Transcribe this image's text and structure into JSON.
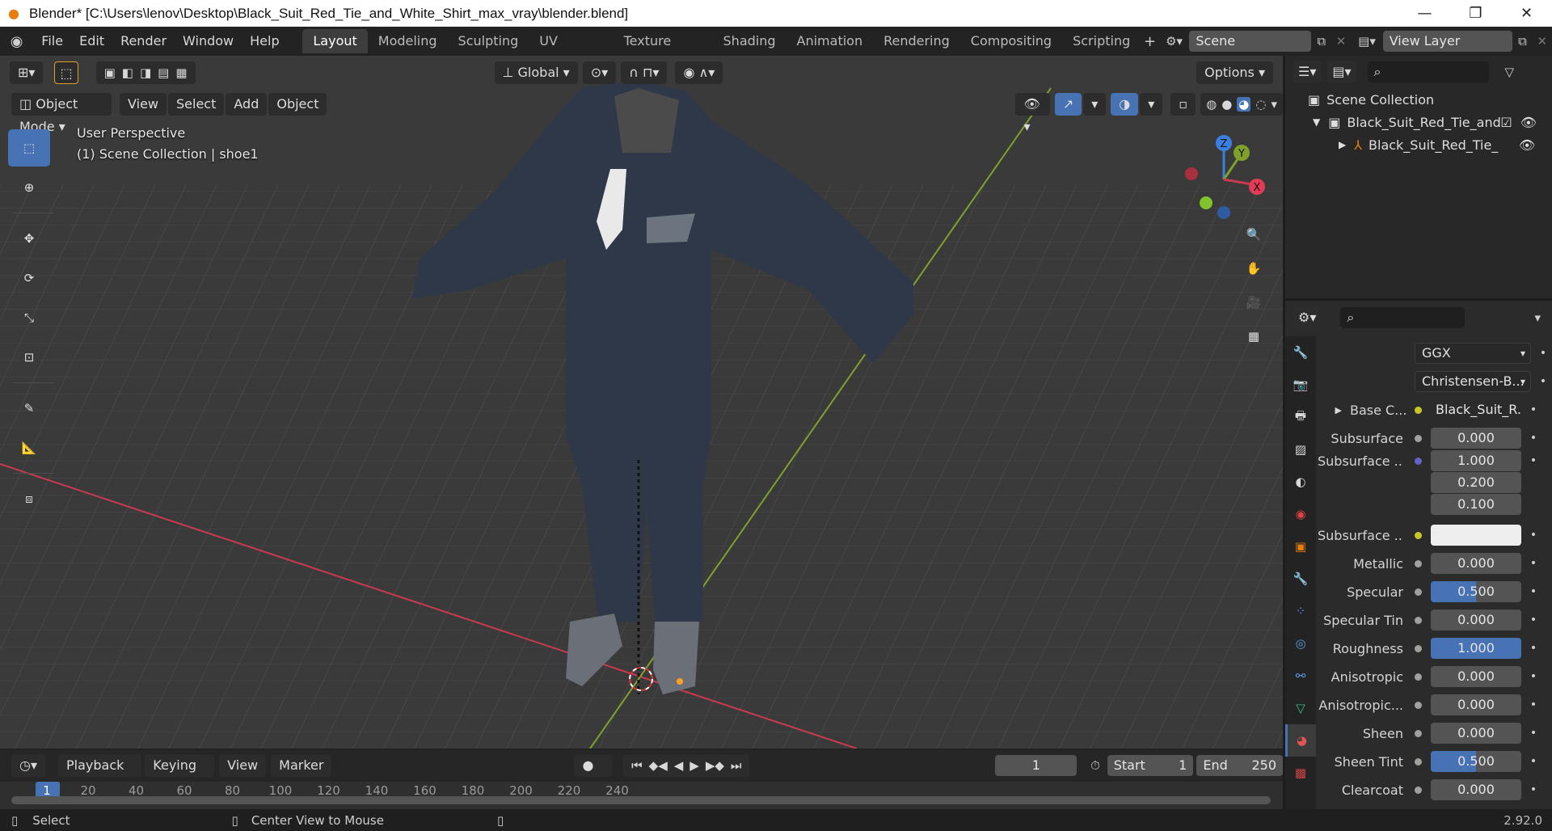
{
  "window": {
    "title": "Blender* [C:\\Users\\lenov\\Desktop\\Black_Suit_Red_Tie_and_White_Shirt_max_vray\\blender.blend]"
  },
  "menu": [
    "File",
    "Edit",
    "Render",
    "Window",
    "Help"
  ],
  "workspace_tabs": [
    "Layout",
    "Modeling",
    "Sculpting",
    "UV Editing",
    "Texture Paint",
    "Shading",
    "Animation",
    "Rendering",
    "Compositing",
    "Scripting"
  ],
  "active_workspace": "Layout",
  "scene_name": "Scene",
  "view_layer": "View Layer",
  "viewport": {
    "header": {
      "transform_orientation": "Global",
      "options": "Options"
    },
    "mode": "Object Mode",
    "menus": [
      "View",
      "Select",
      "Add",
      "Object"
    ],
    "overlay_title": "User Perspective",
    "overlay_subtitle": "(1) Scene Collection | shoe1",
    "gizmo": {
      "z": "Z",
      "y": "Y",
      "x": "X"
    }
  },
  "timeline": {
    "menus": [
      "Playback",
      "Keying",
      "View",
      "Marker"
    ],
    "current_frame": "1",
    "start_label": "Start",
    "start": "1",
    "end_label": "End",
    "end": "250",
    "ruler": [
      "1",
      "20",
      "40",
      "60",
      "80",
      "100",
      "120",
      "140",
      "160",
      "180",
      "200",
      "220",
      "240"
    ]
  },
  "statusbar": {
    "left": "Select",
    "middle": "Center View to Mouse",
    "version": "2.92.0"
  },
  "outliner": {
    "root": "Scene Collection",
    "items": [
      {
        "label": "Black_Suit_Red_Tie_and_"
      },
      {
        "label": "Black_Suit_Red_Tie_"
      }
    ]
  },
  "properties": {
    "distribution": "GGX",
    "subsurface_method": "Christensen-B...",
    "base_color_label": "Base C...",
    "base_color_value": "Black_Suit_R...",
    "rows": [
      {
        "label": "Subsurface",
        "value": "0.000",
        "fill": 0,
        "socket": "#a0a0a0"
      },
      {
        "label": "Subsurface ...",
        "value": "1.000",
        "fill": 0,
        "socket": "#6363c7"
      },
      {
        "label": "",
        "value": "0.200",
        "fill": 0,
        "socket": ""
      },
      {
        "label": "",
        "value": "0.100",
        "fill": 0,
        "socket": ""
      },
      {
        "label": "Subsurface ...",
        "value": "",
        "fill": 0,
        "socket": "#c7c729"
      },
      {
        "label": "Metallic",
        "value": "0.000",
        "fill": 0,
        "socket": "#a0a0a0"
      },
      {
        "label": "Specular",
        "value": "0.500",
        "fill": 0.5,
        "socket": "#a0a0a0"
      },
      {
        "label": "Specular Tin",
        "value": "0.000",
        "fill": 0,
        "socket": "#a0a0a0"
      },
      {
        "label": "Roughness",
        "value": "1.000",
        "fill": 1,
        "socket": "#a0a0a0"
      },
      {
        "label": "Anisotropic",
        "value": "0.000",
        "fill": 0,
        "socket": "#a0a0a0"
      },
      {
        "label": "Anisotropic...",
        "value": "0.000",
        "fill": 0,
        "socket": "#a0a0a0"
      },
      {
        "label": "Sheen",
        "value": "0.000",
        "fill": 0,
        "socket": "#a0a0a0"
      },
      {
        "label": "Sheen Tint",
        "value": "0.500",
        "fill": 0.5,
        "socket": "#a0a0a0"
      },
      {
        "label": "Clearcoat",
        "value": "0.000",
        "fill": 0,
        "socket": "#a0a0a0"
      }
    ]
  },
  "colors": {
    "accent": "#4772b3",
    "x_axis": "#c93a4f",
    "y_axis": "#7fa12c",
    "z_axis": "#3b80e0"
  }
}
